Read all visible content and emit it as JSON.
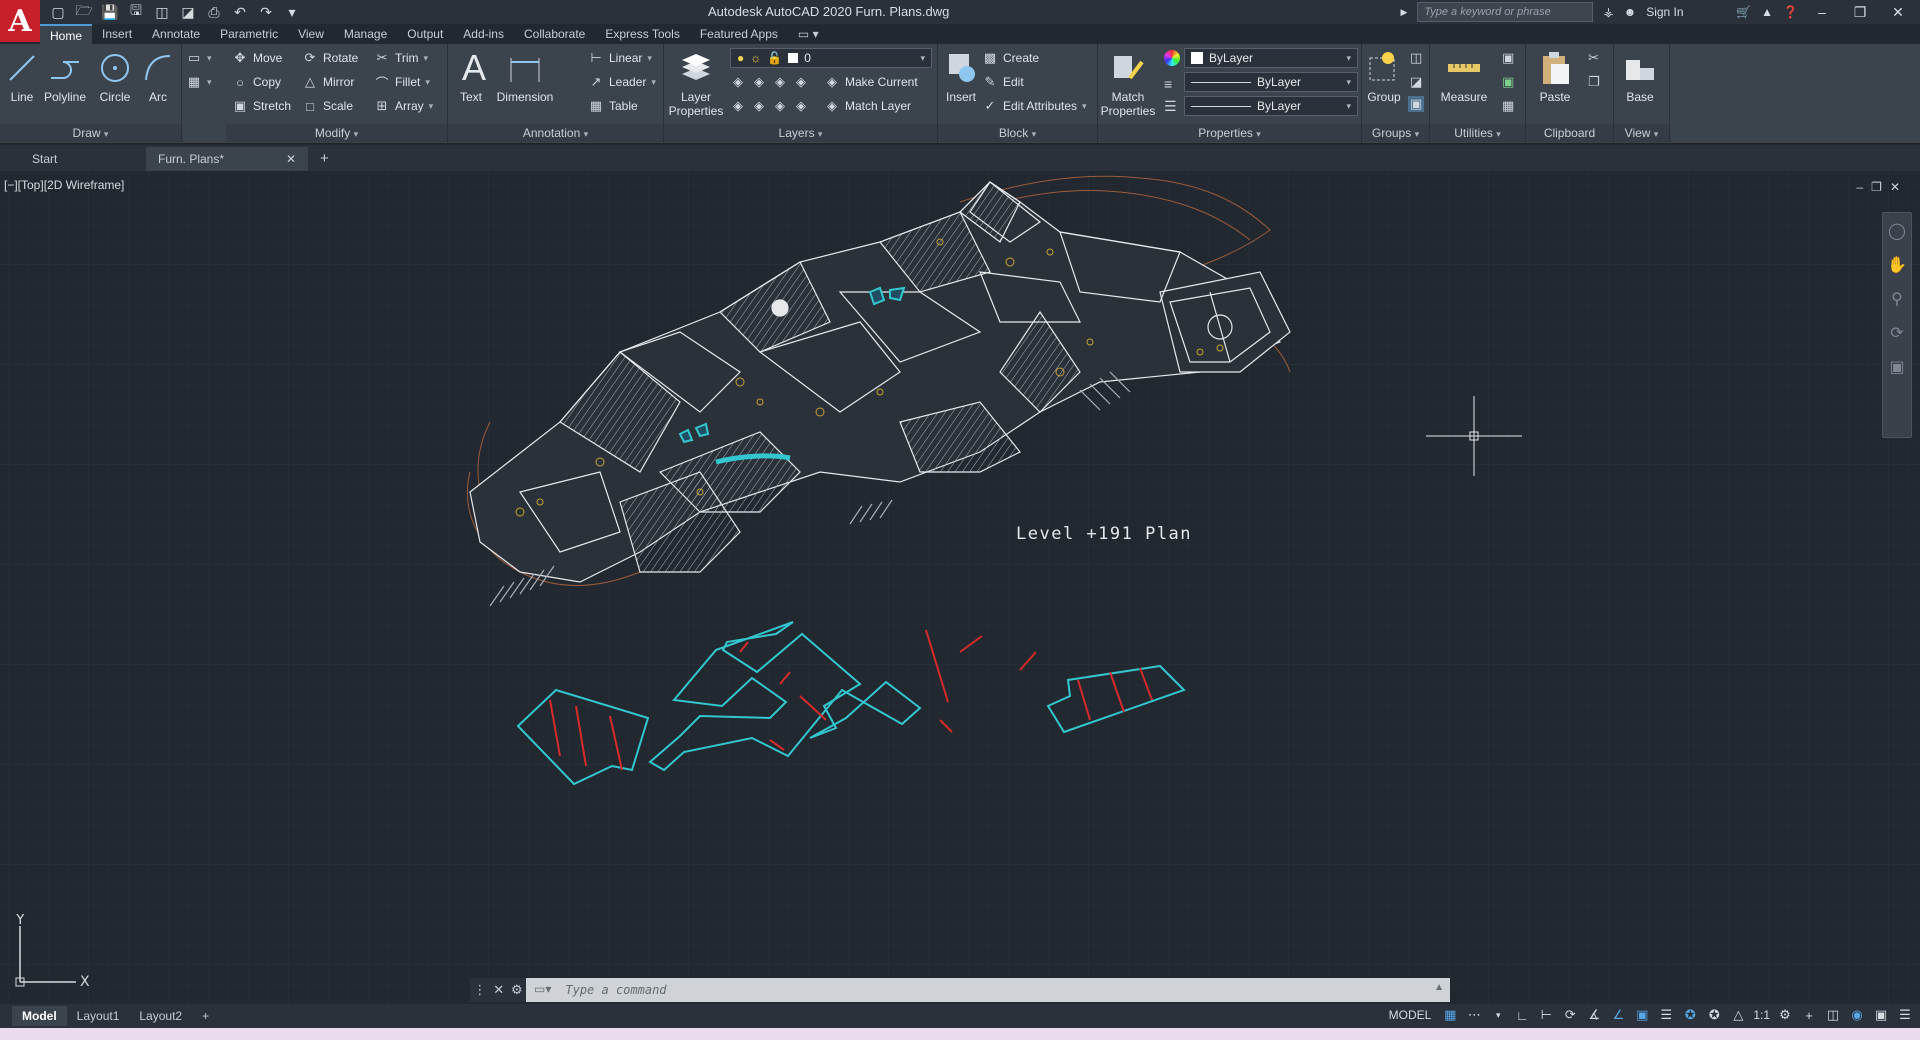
{
  "app": {
    "logo_letter": "A",
    "title": "Autodesk AutoCAD 2020    Furn. Plans.dwg"
  },
  "search": {
    "placeholder": "Type a keyword or phrase"
  },
  "account": {
    "sign_in": "Sign In"
  },
  "menu_tabs": [
    "Home",
    "Insert",
    "Annotate",
    "Parametric",
    "View",
    "Manage",
    "Output",
    "Add-ins",
    "Collaborate",
    "Express Tools",
    "Featured Apps"
  ],
  "ribbon": {
    "draw": {
      "title": "Draw",
      "line": "Line",
      "polyline": "Polyline",
      "circle": "Circle",
      "arc": "Arc"
    },
    "modify": {
      "title": "Modify",
      "move": "Move",
      "rotate": "Rotate",
      "trim": "Trim",
      "copy": "Copy",
      "mirror": "Mirror",
      "fillet": "Fillet",
      "stretch": "Stretch",
      "scale": "Scale",
      "array": "Array"
    },
    "annotation": {
      "title": "Annotation",
      "text": "Text",
      "dimension": "Dimension",
      "linear": "Linear",
      "leader": "Leader",
      "table": "Table"
    },
    "layers": {
      "title": "Layers",
      "layer_properties_1": "Layer",
      "layer_properties_2": "Properties",
      "current_layer": "0",
      "make_current": "Make Current",
      "match_layer": "Match Layer"
    },
    "block": {
      "title": "Block",
      "insert": "Insert",
      "create": "Create",
      "edit": "Edit",
      "edit_attributes": "Edit Attributes"
    },
    "properties": {
      "title": "Properties",
      "match_1": "Match",
      "match_2": "Properties",
      "color": "ByLayer",
      "linetype": "ByLayer",
      "lineweight": "ByLayer"
    },
    "groups": {
      "title": "Groups",
      "group": "Group"
    },
    "utilities": {
      "title": "Utilities",
      "measure": "Measure"
    },
    "clipboard": {
      "title": "Clipboard",
      "paste": "Paste"
    },
    "view": {
      "title": "View",
      "base": "Base"
    }
  },
  "doc_tabs": {
    "start": "Start",
    "active": "Furn. Plans*"
  },
  "viewport": {
    "label": "[−][Top][2D Wireframe]",
    "plan_label": "Level +191 Plan",
    "ucs_x": "X",
    "ucs_y": "Y"
  },
  "command": {
    "placeholder": "Type a command"
  },
  "layouts": [
    "Model",
    "Layout1",
    "Layout2"
  ],
  "status": {
    "model": "MODEL",
    "scale": "1:1"
  },
  "colors": {
    "accent": "#4d9ad8",
    "outline_cyan": "#34c6cf",
    "hatch_red": "#d42b2b",
    "contour": "#a0603c",
    "bg": "#212830"
  }
}
